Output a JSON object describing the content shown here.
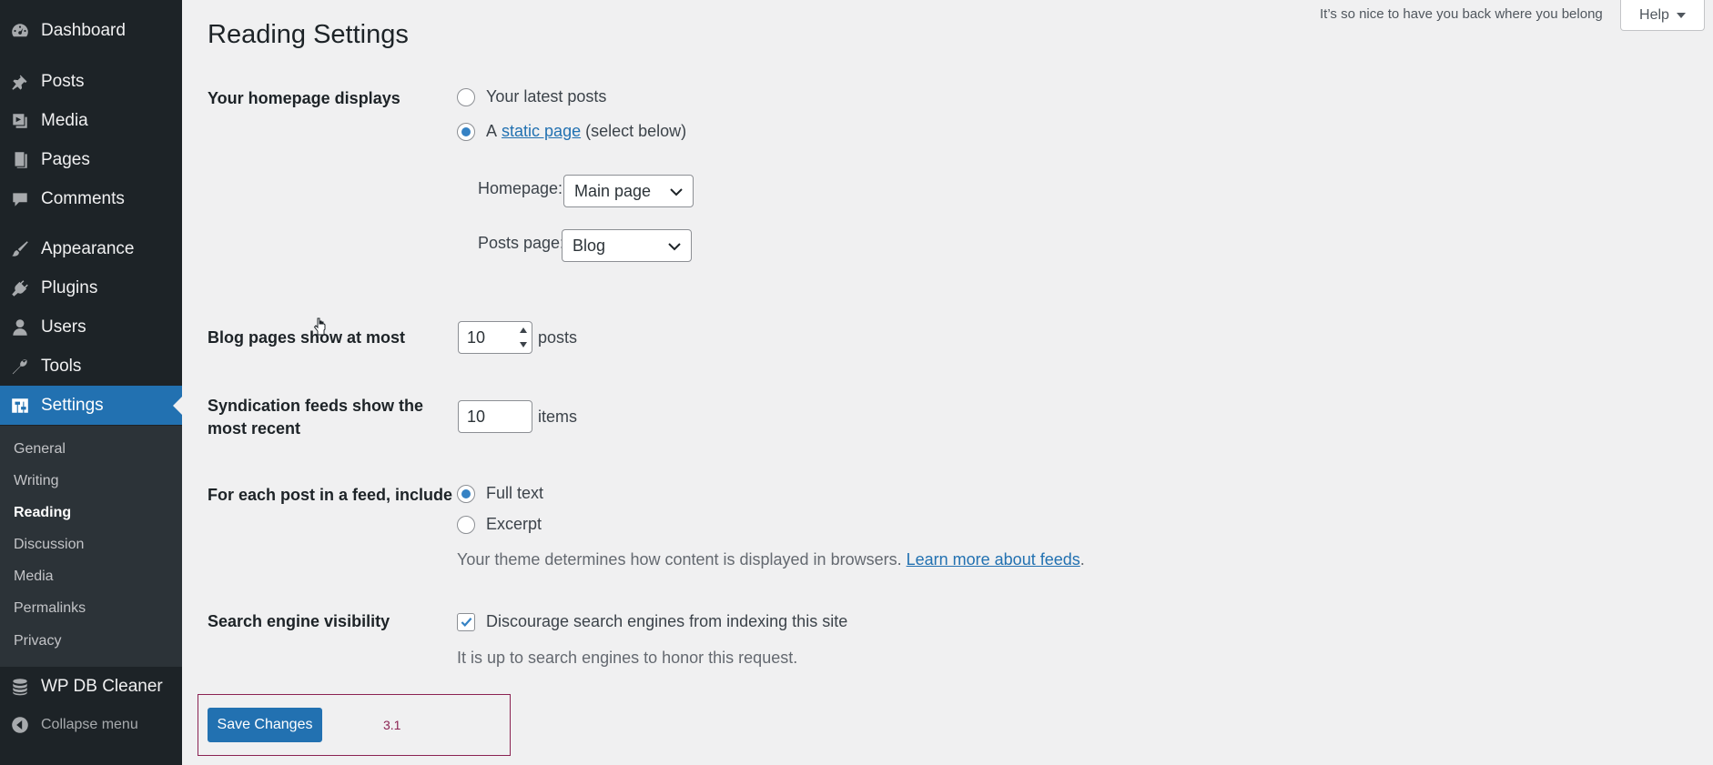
{
  "sidebar": {
    "items": [
      {
        "label": "Dashboard",
        "icon": "dashboard-icon"
      },
      {
        "label": "Posts",
        "icon": "pin-icon"
      },
      {
        "label": "Media",
        "icon": "media-icon"
      },
      {
        "label": "Pages",
        "icon": "pages-icon"
      },
      {
        "label": "Comments",
        "icon": "comment-icon"
      },
      {
        "label": "Appearance",
        "icon": "brush-icon"
      },
      {
        "label": "Plugins",
        "icon": "plug-icon"
      },
      {
        "label": "Users",
        "icon": "user-icon"
      },
      {
        "label": "Tools",
        "icon": "wrench-icon"
      },
      {
        "label": "Settings",
        "icon": "settings-icon"
      },
      {
        "label": "WP DB Cleaner",
        "icon": "database-icon"
      }
    ],
    "submenu": [
      "General",
      "Writing",
      "Reading",
      "Discussion",
      "Media",
      "Permalinks",
      "Privacy"
    ],
    "current_submenu": "Reading",
    "collapse_label": "Collapse menu"
  },
  "header": {
    "title": "Reading Settings",
    "message": "It’s so nice to have you back where you belong",
    "help_label": "Help"
  },
  "form": {
    "homepage_displays": {
      "label": "Your homepage displays",
      "option_latest": "Your latest posts",
      "option_static_prefix": "A",
      "option_static_link": "static page",
      "option_static_suffix": "(select below)",
      "selected": "static"
    },
    "homepage_select": {
      "label": "Homepage:",
      "value": "Main page"
    },
    "posts_page_select": {
      "label": "Posts page:",
      "value": "Blog"
    },
    "blog_pages": {
      "label": "Blog pages show at most",
      "value": "10",
      "unit": "posts"
    },
    "syndication": {
      "label_line1": "Syndication feeds show the",
      "label_line2": "most recent",
      "value": "10",
      "unit": "items"
    },
    "feed_include": {
      "label": "For each post in a feed, include",
      "option_full": "Full text",
      "option_excerpt": "Excerpt",
      "selected": "full",
      "description": "Your theme determines how content is displayed in browsers.",
      "link": "Learn more about feeds",
      "link_suffix": "."
    },
    "search_visibility": {
      "label": "Search engine visibility",
      "checkbox_label": "Discourage search engines from indexing this site",
      "checked": true,
      "description": "It is up to search engines to honor this request."
    },
    "save_label": "Save Changes",
    "annotation": "3.1"
  },
  "colors": {
    "accent": "#2271b1",
    "sidebar_bg": "#1d2327",
    "submenu_bg": "#2c3338",
    "page_bg": "#f0f0f1",
    "annotation_frame": "#8b2252"
  }
}
